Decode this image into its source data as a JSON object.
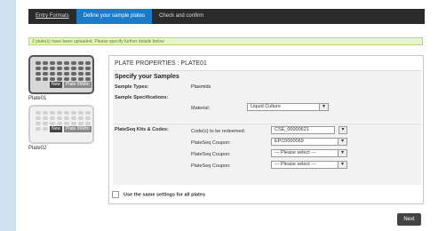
{
  "nav": {
    "tabs": [
      {
        "label": "Entry Formats"
      },
      {
        "label": "Define your sample plates"
      },
      {
        "label": "Check and confirm"
      }
    ]
  },
  "notice": "2 plate(s) have been uploaded. Please specify further details below",
  "plates": [
    {
      "label": "Plate01",
      "badge_new": "New",
      "badge_plate": "Plate 96Mm"
    },
    {
      "label": "Plate02",
      "badge_new": "New",
      "badge_plate": "Plate 96Mm"
    }
  ],
  "panel": {
    "title": "PLATE PROPERTIES : PLATE01",
    "specify_title": "Specify your Samples",
    "sample_types_label": "Sample Types:",
    "sample_types_value": "Plasmids",
    "sample_specs_label": "Sample Specifications:",
    "material_label": "Material:",
    "material_value": "Liquid Culture",
    "kits_label": "PlateSeq Kits & Codes:",
    "codes_label": "Code(s) to be redeemed:",
    "codes_value": "CSE_00000621",
    "coupon_label": "PlateSeq Coupon:",
    "coupons": [
      "EPC0000069",
      "--- Please select ---",
      "--- Please select ---"
    ],
    "same_settings_label": "Use the same settings for all plates"
  },
  "next_label": "Next",
  "icons": {
    "dropdown": "chevron-down-icon"
  }
}
